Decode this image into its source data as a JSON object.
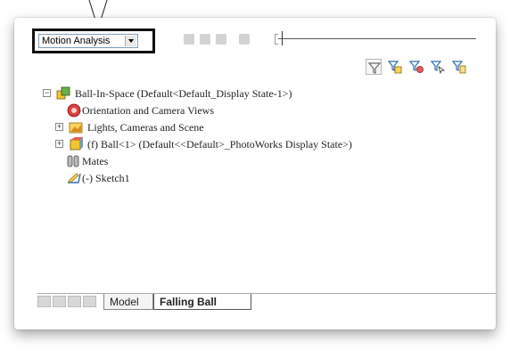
{
  "toolbar": {
    "study_type": "Motion Analysis",
    "buttons": [
      "calculate-icon",
      "play-icon",
      "play-from-start-icon",
      "stop-icon"
    ]
  },
  "filters": [
    {
      "name": "filter-icon",
      "color": "#6a6a6a"
    },
    {
      "name": "filter-animation-icon",
      "color": "#2f6fb0"
    },
    {
      "name": "filter-driving-icon",
      "color": "#2f6fb0"
    },
    {
      "name": "filter-selected-icon",
      "color": "#2f6fb0"
    },
    {
      "name": "filter-results-icon",
      "color": "#2f6fb0"
    }
  ],
  "tree": {
    "root": {
      "label": "Ball-In-Space  (Default<Default_Display State-1>)",
      "expander": "−",
      "icon": "assembly-icon"
    },
    "items": [
      {
        "label": "Orientation and Camera Views",
        "icon": "camera-views-icon"
      },
      {
        "label": "Lights, Cameras and Scene",
        "icon": "lights-scene-icon",
        "expander": "+"
      },
      {
        "label": "(f) Ball<1> (Default<<Default>_PhotoWorks Display State>)",
        "icon": "part-icon",
        "expander": "+"
      },
      {
        "label": "Mates",
        "icon": "mates-icon"
      },
      {
        "label": "(-) Sketch1",
        "icon": "sketch-icon"
      }
    ]
  },
  "tabs": [
    {
      "label": "Model",
      "active": false
    },
    {
      "label": "Falling Ball",
      "active": true
    }
  ],
  "colors": {
    "accent": "#2f6fb0",
    "dropdown_border": "#111111"
  }
}
